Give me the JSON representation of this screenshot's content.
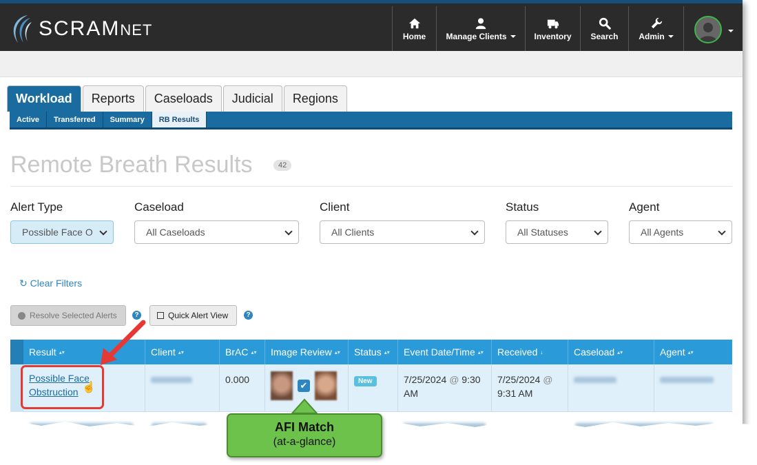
{
  "brand": {
    "name": "SCRAM",
    "suffix": "NET"
  },
  "nav": {
    "home": "Home",
    "manage_clients": "Manage Clients",
    "inventory": "Inventory",
    "search": "Search",
    "admin": "Admin"
  },
  "tabs": [
    "Workload",
    "Reports",
    "Caseloads",
    "Judicial",
    "Regions"
  ],
  "subtabs": [
    "Active",
    "Transferred",
    "Summary",
    "RB Results"
  ],
  "page": {
    "title": "Remote Breath Results",
    "count": "42"
  },
  "filters": {
    "alert_type": {
      "label": "Alert Type",
      "value": "Possible Face O"
    },
    "caseload": {
      "label": "Caseload",
      "value": "All Caseloads"
    },
    "client": {
      "label": "Client",
      "value": "All Clients"
    },
    "status": {
      "label": "Status",
      "value": "All Statuses"
    },
    "agent": {
      "label": "Agent",
      "value": "All Agents"
    }
  },
  "clear_filters": "Clear Filters",
  "actions": {
    "resolve": "Resolve Selected Alerts",
    "quick_view": "Quick Alert View",
    "help": "?"
  },
  "table": {
    "headers": [
      "Result",
      "Client",
      "BrAC",
      "Image Review",
      "Status",
      "Event Date/Time",
      "Received",
      "Caseload",
      "Agent"
    ],
    "row": {
      "result_line1": "Possible Face",
      "result_line2": "Obstruction",
      "brac": "0.000",
      "status": "New",
      "event_date": "7/25/2024",
      "event_time": "9:30",
      "event_ampm": "AM",
      "received_date": "7/25/2024",
      "received_time": "9:31 AM",
      "at": "@"
    }
  },
  "callout": {
    "title": "AFI Match",
    "subtitle": "(at-a-glance)"
  },
  "colors": {
    "header_blue": "#2a9bd8",
    "tab_blue": "#1a6ba0",
    "callout_red": "#e53935",
    "callout_green": "#6cc24a"
  }
}
